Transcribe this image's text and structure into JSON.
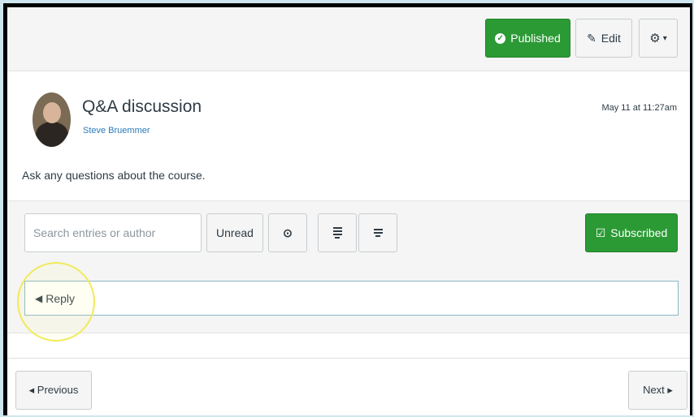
{
  "toolbar": {
    "published_label": "Published",
    "edit_label": "Edit",
    "gear_caret": "▾"
  },
  "discussion": {
    "title": "Q&A discussion",
    "author": "Steve Bruemmer",
    "date": "May 11 at 11:27am",
    "message": "Ask any questions about the course."
  },
  "filters": {
    "search_placeholder": "Search entries or author",
    "unread_label": "Unread",
    "subscribed_label": "Subscribed"
  },
  "reply": {
    "label": "Reply"
  },
  "pagination": {
    "previous_label": "◂ Previous",
    "next_label": "Next ▸"
  },
  "colors": {
    "accent_green": "#2b9a35",
    "link_blue": "#2b7abc",
    "highlight_yellow": "#f1ea5a"
  }
}
